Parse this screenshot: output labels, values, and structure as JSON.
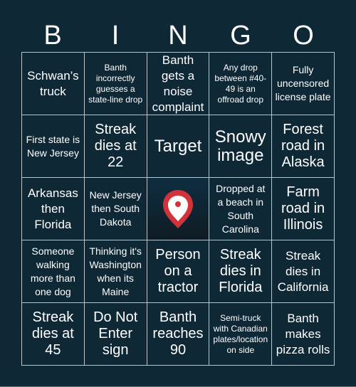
{
  "header": {
    "letters": [
      "B",
      "I",
      "N",
      "G",
      "O"
    ]
  },
  "board": {
    "cells": [
      "Schwan’s truck",
      "Banth incorrectly guesses a state-line drop",
      "Banth gets a noise complaint",
      "Any drop between #40-49 is an offroad drop",
      "Fully uncensored license plate",
      "First state is New Jersey",
      "Streak dies at 22",
      "Target",
      "Snowy image",
      "Forest road in Alaska",
      "Arkansas then Florida",
      "New Jersey then South Dakota",
      "",
      "Dropped at a beach in South Carolina",
      "Farm road in Illinois",
      "Someone walking more than one dog",
      "Thinking it's Washington when its Maine",
      "Person on a tractor",
      "Streak dies in Florida",
      "Streak dies in California",
      "Streak dies at 45",
      "Do Not Enter sign",
      "Banth reaches 90",
      "Semi-truck with Canadian plates/location on side",
      "Banth makes pizza rolls"
    ],
    "free_space_icon": "map-pin-icon",
    "colors": {
      "background": "#0f2836",
      "grid_line": "#b9c3c8",
      "pin": "#d0343a",
      "text": "#ffffff"
    }
  }
}
